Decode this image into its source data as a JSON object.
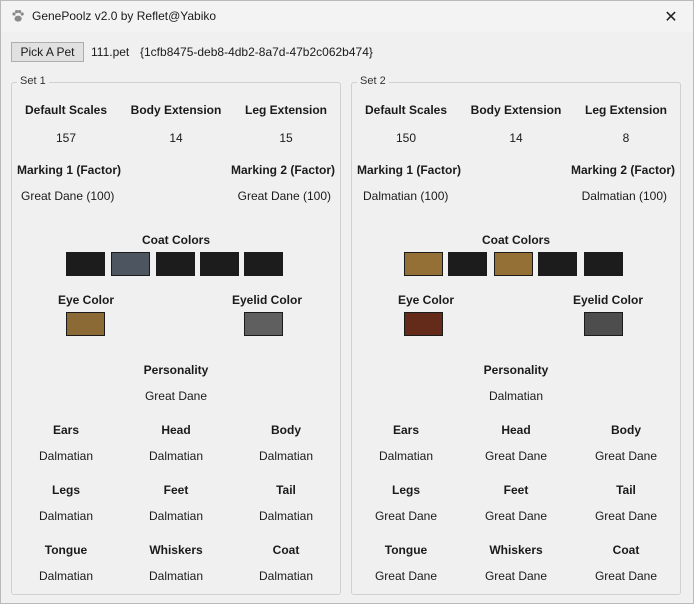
{
  "window": {
    "title": "GenePoolz v2.0 by Reflet@Yabiko",
    "close_glyph": "✕",
    "icon": "paw-icon"
  },
  "toolbar": {
    "pick_label": "Pick A Pet",
    "file_name": "111.pet",
    "guid": "{1cfb8475-deb8-4db2-8a7d-47b2c062b474}"
  },
  "labels": {
    "default_scales": "Default Scales",
    "body_extension": "Body Extension",
    "leg_extension": "Leg Extension",
    "marking1": "Marking 1 (Factor)",
    "marking2": "Marking 2 (Factor)",
    "coat_colors": "Coat Colors",
    "eye_color": "Eye Color",
    "eyelid_color": "Eyelid Color",
    "personality": "Personality",
    "ears": "Ears",
    "head": "Head",
    "body": "Body",
    "legs": "Legs",
    "feet": "Feet",
    "tail": "Tail",
    "tongue": "Tongue",
    "whiskers": "Whiskers",
    "coat": "Coat"
  },
  "set1": {
    "legend": "Set 1",
    "default_scales": "157",
    "body_extension": "14",
    "leg_extension": "15",
    "marking1": "Great Dane (100)",
    "marking2": "Great Dane (100)",
    "coat_colors": [
      "#1c1c1c",
      "#4d5560",
      "#1c1c1c",
      "#1c1c1c",
      "#1c1c1c"
    ],
    "eye_color": "#8b6a36",
    "eyelid_color": "#5f5f5f",
    "personality": "Great Dane",
    "ears": "Dalmatian",
    "head": "Dalmatian",
    "body": "Dalmatian",
    "legs": "Dalmatian",
    "feet": "Dalmatian",
    "tail": "Dalmatian",
    "tongue": "Dalmatian",
    "whiskers": "Dalmatian",
    "coat": "Dalmatian"
  },
  "set2": {
    "legend": "Set 2",
    "default_scales": "150",
    "body_extension": "14",
    "leg_extension": "8",
    "marking1": "Dalmatian (100)",
    "marking2": "Dalmatian (100)",
    "coat_colors": [
      "#946f36",
      "#1c1c1c",
      "#946f36",
      "#1c1c1c",
      "#1c1c1c"
    ],
    "eye_color": "#642b1a",
    "eyelid_color": "#4d4d4d",
    "personality": "Dalmatian",
    "ears": "Dalmatian",
    "head": "Great Dane",
    "body": "Great Dane",
    "legs": "Great Dane",
    "feet": "Great Dane",
    "tail": "Great Dane",
    "tongue": "Great Dane",
    "whiskers": "Great Dane",
    "coat": "Great Dane"
  }
}
